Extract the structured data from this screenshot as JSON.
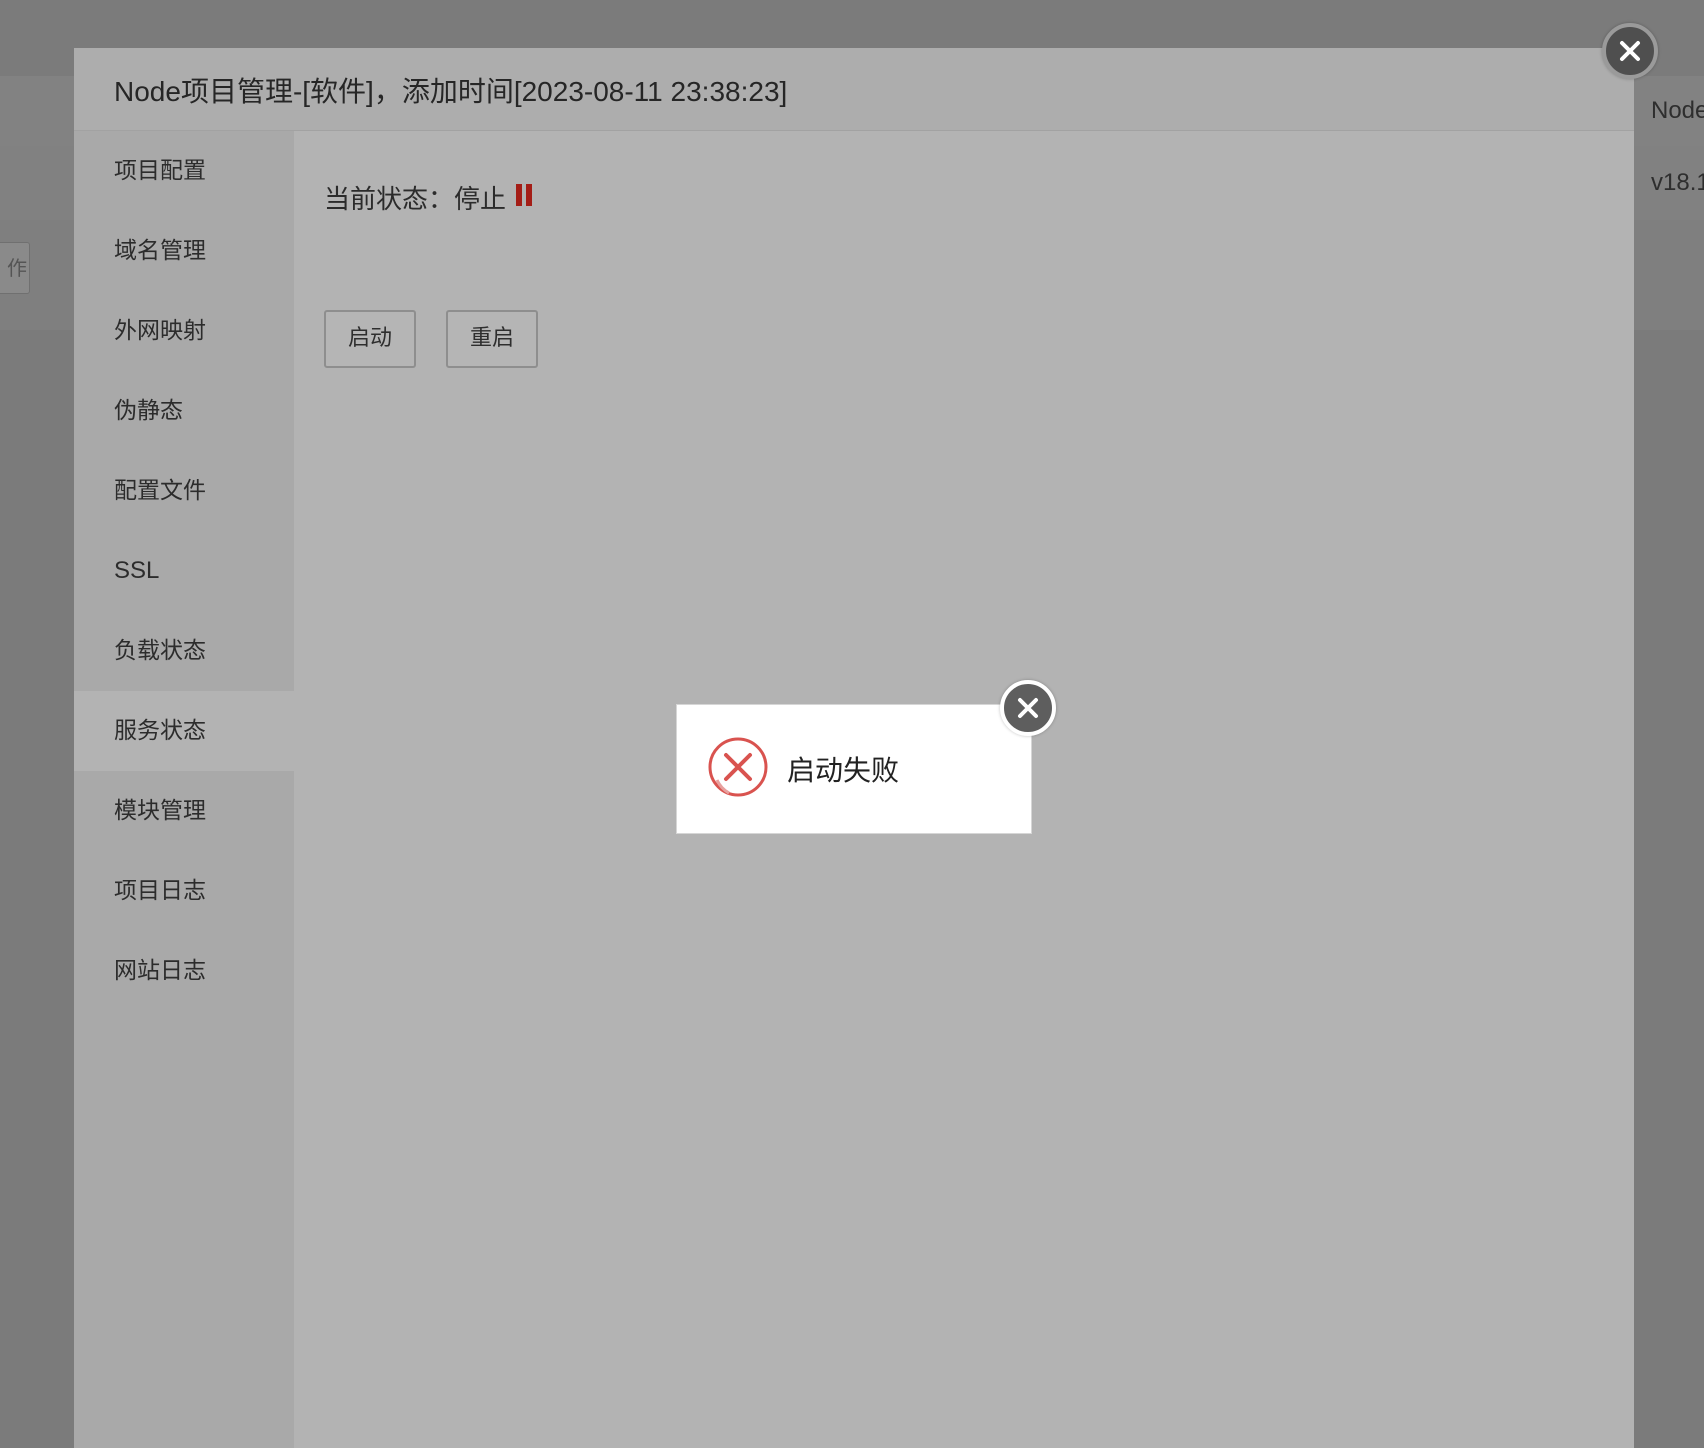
{
  "background": {
    "header_col_label": "Node",
    "row_value": "v18.1",
    "partial_button_label": "作"
  },
  "dialog": {
    "title": "Node项目管理-[软件]，添加时间[2023-08-11 23:38:23]",
    "close_icon": "close-icon"
  },
  "sidebar": {
    "items": [
      {
        "label": "项目配置"
      },
      {
        "label": "域名管理"
      },
      {
        "label": "外网映射"
      },
      {
        "label": "伪静态"
      },
      {
        "label": "配置文件"
      },
      {
        "label": "SSL"
      },
      {
        "label": "负载状态"
      },
      {
        "label": "服务状态",
        "active": true
      },
      {
        "label": "模块管理"
      },
      {
        "label": "项目日志"
      },
      {
        "label": "网站日志"
      }
    ]
  },
  "service": {
    "status_label": "当前状态：",
    "status_value": "停止",
    "status_icon": "pause-icon",
    "status_color": "#a41d16",
    "start_button": "启动",
    "restart_button": "重启"
  },
  "toast": {
    "message": "启动失败",
    "icon": "error-x-icon",
    "icon_color": "#d9534f",
    "close_icon": "close-icon"
  }
}
